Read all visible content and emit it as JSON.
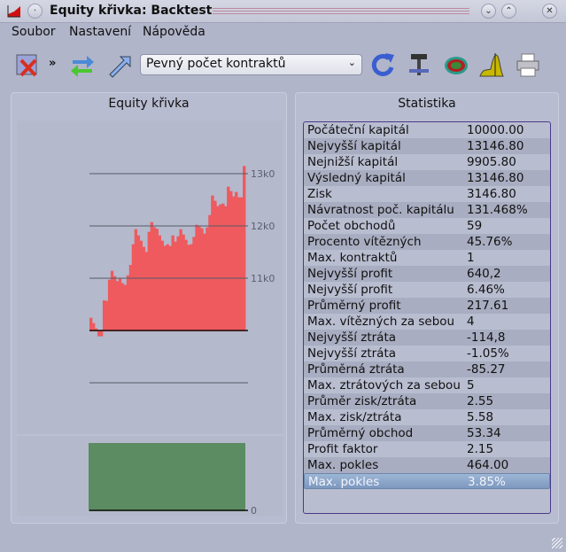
{
  "window": {
    "title": "Equity křivka: Backtest"
  },
  "menu": [
    "Soubor",
    "Nastavení",
    "Nápověda"
  ],
  "toolbar": {
    "overflow": "»",
    "mode_select": "Pevný počet kontraktů"
  },
  "colors": {
    "equity": "#ee5a5e",
    "drawdown": "#5b8c62",
    "selection": "#8aa6cb"
  },
  "left_panel": {
    "title": "Equity křivka"
  },
  "right_panel": {
    "title": "Statistika"
  },
  "chart_data": {
    "type": "bar",
    "title": "Equity křivka",
    "xlabel": "",
    "ylabel": "",
    "ylim": [
      9000,
      13300
    ],
    "baseline": 10000,
    "yticks": [
      {
        "value": 11000,
        "label": "11k0"
      },
      {
        "value": 12000,
        "label": "12k0"
      },
      {
        "value": 13000,
        "label": "13k0"
      }
    ],
    "values": [
      10243,
      10141,
      10040,
      9906,
      9906,
      10576,
      10565,
      10972,
      11141,
      11040,
      10944,
      11000,
      10904,
      10870,
      11056,
      11254,
      11650,
      11938,
      11819,
      11718,
      11599,
      11503,
      11887,
      12073,
      11977,
      11944,
      11819,
      11718,
      11621,
      11650,
      11616,
      11819,
      11700,
      11802,
      11938,
      11836,
      11735,
      11638,
      11650,
      11791,
      12022,
      11989,
      11955,
      11853,
      11972,
      12209,
      12582,
      12480,
      12378,
      12412,
      12429,
      12378,
      12751,
      12666,
      12565,
      12650,
      12548,
      12548,
      13147
    ],
    "drawdown": {
      "label": "0",
      "ylim": [
        0,
        1
      ]
    }
  },
  "stats": [
    {
      "k": "Počáteční kapitál",
      "v": "10000.00"
    },
    {
      "k": "Nejvyšší kapitál",
      "v": "13146.80"
    },
    {
      "k": "Nejnižší kapitál",
      "v": "9905.80"
    },
    {
      "k": "Výsledný kapitál",
      "v": "13146.80"
    },
    {
      "k": "Zisk",
      "v": "3146.80"
    },
    {
      "k": "Návratnost poč. kapitálu",
      "v": "131.468%"
    },
    {
      "k": "Počet obchodů",
      "v": "59"
    },
    {
      "k": "Procento vítězných",
      "v": "45.76%"
    },
    {
      "k": "Max. kontraktů",
      "v": "1"
    },
    {
      "k": "Nejvyšší profit",
      "v": "640,2"
    },
    {
      "k": "Nejvyšší profit",
      "v": "6.46%"
    },
    {
      "k": "Průměrný profit",
      "v": "217.61"
    },
    {
      "k": "Max. vítězných za sebou",
      "v": "4"
    },
    {
      "k": "Nejvyšší ztráta",
      "v": "-114,8"
    },
    {
      "k": "Nejvyšší ztráta",
      "v": "-1.05%"
    },
    {
      "k": "Průměrná ztráta",
      "v": "-85.27"
    },
    {
      "k": "Max. ztrátových za sebou",
      "v": "5"
    },
    {
      "k": "Průměr zisk/ztráta",
      "v": "2.55"
    },
    {
      "k": "Max. zisk/ztráta",
      "v": "5.58"
    },
    {
      "k": "Průměrný obchod",
      "v": "53.34"
    },
    {
      "k": "Profit faktor",
      "v": "2.15"
    },
    {
      "k": "Max. pokles",
      "v": "464.00"
    },
    {
      "k": "Max. pokles",
      "v": "3.85%"
    }
  ]
}
